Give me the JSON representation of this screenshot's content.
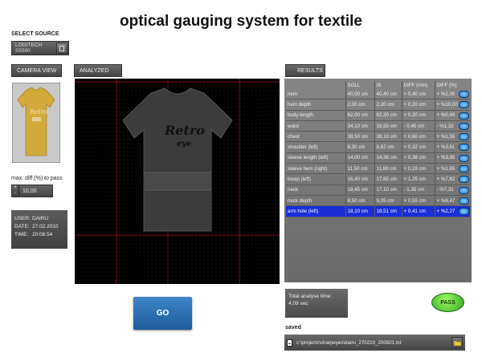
{
  "app": {
    "title": "optical gauging system for textile"
  },
  "source": {
    "label": "SELECT SOURCE",
    "value": "LOGITECH S5500",
    "icon": "dropdown-icon"
  },
  "tabs": {
    "camera_view": "CAMERA VIEW",
    "analyzed": "ANALYZED",
    "results": "RESULTS"
  },
  "camera_shirt": {
    "text": "Retro",
    "color": "#d2a93a"
  },
  "analyzed_shirt": {
    "text_line1": "Retro",
    "text_line2": "eye",
    "color": "#3c3c3c"
  },
  "pass_threshold": {
    "label": "max. diff.(%) to pass",
    "value": "10,00",
    "plus": "+",
    "minus": "-"
  },
  "session": {
    "user_label": "USER:",
    "user": "DAIRU",
    "date_label": "DATE:",
    "date": "27.02.2010",
    "time_label": "TIME:",
    "time": "20:08:54"
  },
  "go_button": {
    "label": "GO"
  },
  "results": {
    "columns": [
      "",
      "SOLL",
      "IS",
      "DIFF (mm)",
      "DIFF (%)"
    ],
    "rows": [
      {
        "name": "hem",
        "soll": "40,00 cm",
        "is": "40,40 cm",
        "diff_mm": "+ 0,40 cm",
        "diff_pct": "+ %1,00"
      },
      {
        "name": "hem depth",
        "soll": "2,00 cm",
        "is": "2,20 cm",
        "diff_mm": "+ 0,20 cm",
        "diff_pct": "+ %10,00"
      },
      {
        "name": "body length",
        "soll": "62,00 cm",
        "is": "62,30 cm",
        "diff_mm": "+ 0,30 cm",
        "diff_pct": "+ %0,49"
      },
      {
        "name": "waist",
        "soll": "34,10 cm",
        "is": "33,55 cm",
        "diff_mm": "- 0,45 cm",
        "diff_pct": "- %1,32"
      },
      {
        "name": "chest",
        "soll": "38,50 cm",
        "is": "39,10 cm",
        "diff_mm": "+ 0,60 cm",
        "diff_pct": "+ %1,55"
      },
      {
        "name": "shoulder (left)",
        "soll": "8,30 cm",
        "is": "8,62 cm",
        "diff_mm": "+ 0,32 cm",
        "diff_pct": "+ %3,61"
      },
      {
        "name": "sleeve length (left)",
        "soll": "14,00 cm",
        "is": "14,38 cm",
        "diff_mm": "+ 0,38 cm",
        "diff_pct": "+ %3,85"
      },
      {
        "name": "sleeve hem (right)",
        "soll": "11,50 cm",
        "is": "11,69 cm",
        "diff_mm": "+ 0,19 cm",
        "diff_pct": "+ %1,65"
      },
      {
        "name": "bicep (left)",
        "soll": "16,40 cm",
        "is": "17,65 cm",
        "diff_mm": "+ 1,25 cm",
        "diff_pct": "+ %7,62"
      },
      {
        "name": "neck",
        "soll": "18,45 cm",
        "is": "17,10 cm",
        "diff_mm": "- 1,35 cm",
        "diff_pct": "- %7,31"
      },
      {
        "name": "neck depth",
        "soll": "8,50 cm",
        "is": "9,05 cm",
        "diff_mm": "+ 0,55 cm",
        "diff_pct": "+ %6,47"
      },
      {
        "name": "arm hole (left)",
        "soll": "18,10 cm",
        "is": "18,51 cm",
        "diff_mm": "+ 0,41 cm",
        "diff_pct": "+ %2,27",
        "selected": true
      }
    ],
    "row_icon": "blue-dot-icon",
    "selected_color": "#1a2ed8"
  },
  "analyse": {
    "label": "Total analyse time:",
    "value": "4,09 sec"
  },
  "pass_button": {
    "label": "PASS",
    "color": "#3fcc2a"
  },
  "saved": {
    "label": "saved",
    "path": "c:\\projects\\sharpeyes\\dairu_270210_200501.txt",
    "icon": "file-icon",
    "folder_icon": "folder-icon"
  }
}
